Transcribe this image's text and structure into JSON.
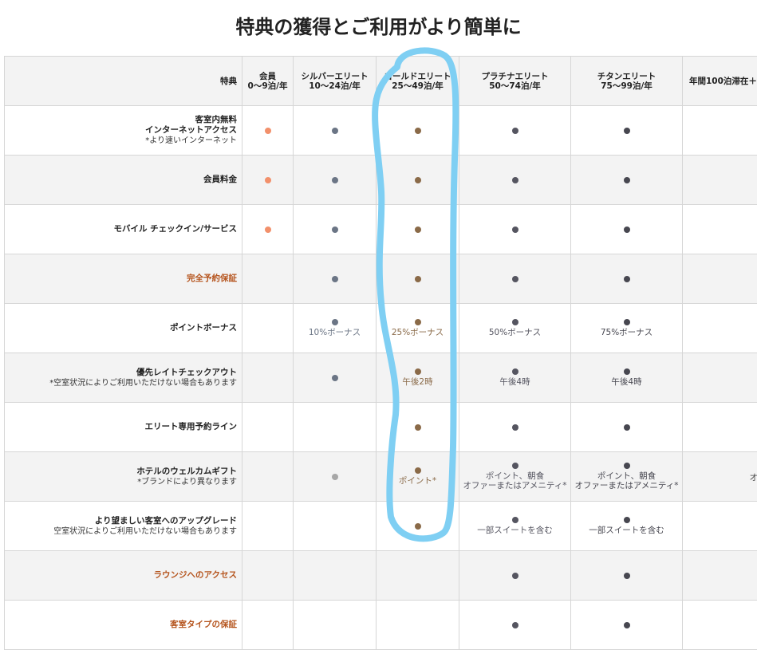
{
  "page_title": "特典の獲得とご利用がより簡単に",
  "colors": {
    "member": "#f2906b",
    "silver": "#6b7585",
    "gold": "#8a6a48",
    "platinum": "#555560",
    "titanium": "#474750",
    "gold_light": "#a7a7a7",
    "feature_orange": "#b5541d",
    "highlight": "#7fcff3"
  },
  "header": {
    "feature": "特典",
    "tiers": [
      {
        "name": "会員",
        "nights": "0～9泊/年"
      },
      {
        "name": "シルバーエリート",
        "nights": "10～24泊/年"
      },
      {
        "name": "ゴールドエリート",
        "nights": "25～49泊/年"
      },
      {
        "name": "プラチナエリート",
        "nights": "50～74泊/年"
      },
      {
        "name": "チタンエリート",
        "nights": "75～99泊/年"
      },
      {
        "name": "年間100泊滞在＋",
        "nights": ""
      }
    ]
  },
  "rows": [
    {
      "name": "客室内無料",
      "name2": "インターネットアクセス",
      "note": "*より速いインターネット",
      "orange": false,
      "cells": [
        {
          "dot": "member"
        },
        {
          "dot": "silver"
        },
        {
          "dot": "gold"
        },
        {
          "dot": "platinum"
        },
        {
          "dot": "titanium"
        },
        {}
      ]
    },
    {
      "name": "会員料金",
      "name2": "",
      "note": "",
      "orange": false,
      "cells": [
        {
          "dot": "member"
        },
        {
          "dot": "silver"
        },
        {
          "dot": "gold"
        },
        {
          "dot": "platinum"
        },
        {
          "dot": "titanium"
        },
        {}
      ]
    },
    {
      "name": "モバイル チェックイン/サービス",
      "name2": "",
      "note": "",
      "orange": false,
      "cells": [
        {
          "dot": "member"
        },
        {
          "dot": "silver"
        },
        {
          "dot": "gold"
        },
        {
          "dot": "platinum"
        },
        {
          "dot": "titanium"
        },
        {}
      ]
    },
    {
      "name": "完全予約保証",
      "name2": "",
      "note": "",
      "orange": true,
      "cells": [
        {},
        {
          "dot": "silver"
        },
        {
          "dot": "gold"
        },
        {
          "dot": "platinum"
        },
        {
          "dot": "titanium"
        },
        {}
      ]
    },
    {
      "name": "ポイントボーナス",
      "name2": "",
      "note": "",
      "orange": false,
      "cells": [
        {},
        {
          "dot": "silver",
          "text": "10%ボーナス"
        },
        {
          "dot": "gold",
          "text": "25%ボーナス"
        },
        {
          "dot": "platinum",
          "text": "50%ボーナス"
        },
        {
          "dot": "titanium",
          "text": "75%ボーナス"
        },
        {}
      ]
    },
    {
      "name": "優先レイトチェックアウト",
      "name2": "",
      "note": "*空室状況によりご利用いただけない場合もあります",
      "orange": false,
      "cells": [
        {},
        {
          "dot": "silver"
        },
        {
          "dot": "gold",
          "text": "午後2時"
        },
        {
          "dot": "platinum",
          "text": "午後4時"
        },
        {
          "dot": "titanium",
          "text": "午後4時"
        },
        {}
      ]
    },
    {
      "name": "エリート専用予約ライン",
      "name2": "",
      "note": "",
      "orange": false,
      "cells": [
        {},
        {},
        {
          "dot": "gold"
        },
        {
          "dot": "platinum"
        },
        {
          "dot": "titanium"
        },
        {}
      ]
    },
    {
      "name": "ホテルのウェルカムギフト",
      "name2": "",
      "note": "*ブランドにより異なります",
      "orange": false,
      "cells": [
        {},
        {
          "dot": "gold_light"
        },
        {
          "dot": "gold",
          "text": "ポイント*"
        },
        {
          "dot": "platinum",
          "text": "ポイント、朝食",
          "text2": "オファーまたはアメニティ*"
        },
        {
          "dot": "titanium",
          "text": "ポイント、朝食",
          "text2": "オファーまたはアメニティ*"
        },
        {
          "text": "オ"
        }
      ]
    },
    {
      "name": "より望ましい客室へのアップグレード",
      "name2": "",
      "note": "空室状況によりご利用いただけない場合もあります",
      "orange": false,
      "cells": [
        {},
        {},
        {
          "dot": "gold"
        },
        {
          "dot": "platinum",
          "text": "一部スイートを含む"
        },
        {
          "dot": "titanium",
          "text": "一部スイートを含む"
        },
        {}
      ]
    },
    {
      "name": "ラウンジへのアクセス",
      "name2": "",
      "note": "",
      "orange": true,
      "cells": [
        {},
        {},
        {},
        {
          "dot": "platinum"
        },
        {
          "dot": "titanium"
        },
        {}
      ]
    },
    {
      "name": "客室タイプの保証",
      "name2": "",
      "note": "",
      "orange": true,
      "cells": [
        {},
        {},
        {},
        {
          "dot": "platinum"
        },
        {
          "dot": "titanium"
        },
        {}
      ]
    }
  ]
}
